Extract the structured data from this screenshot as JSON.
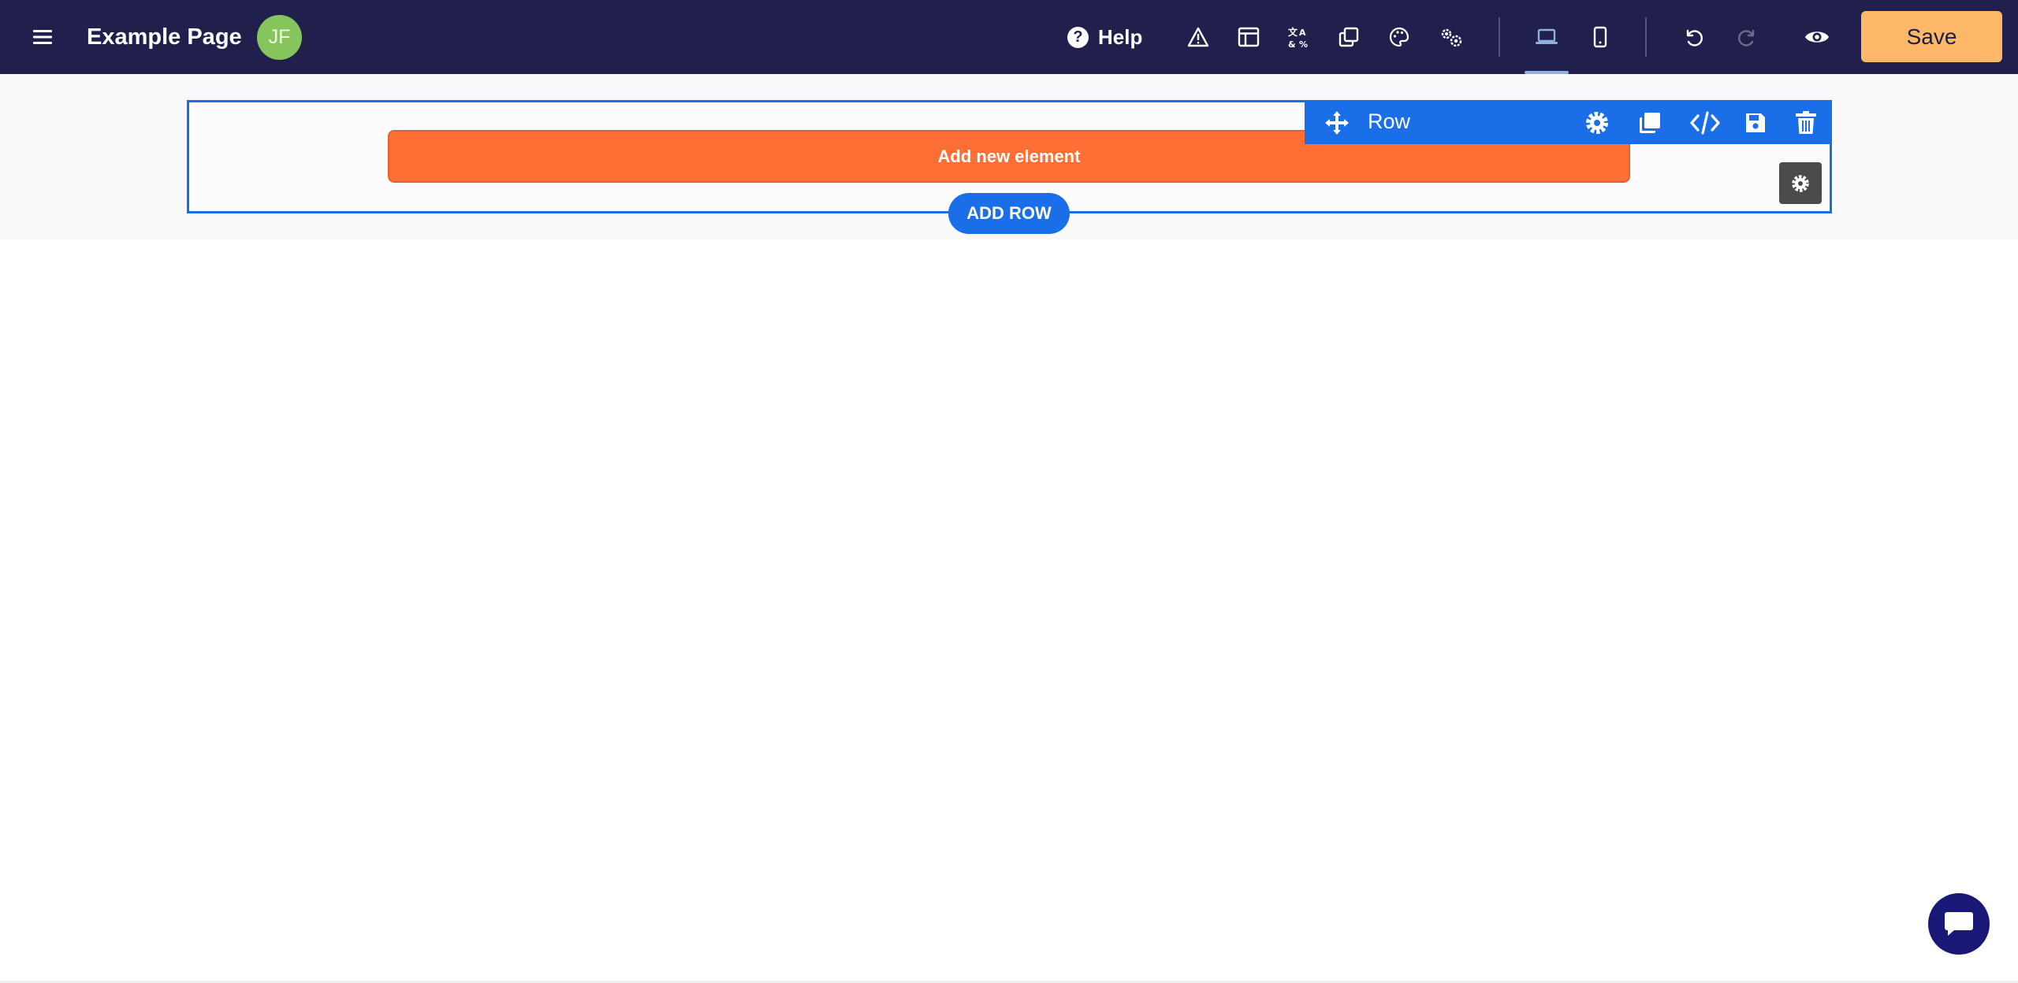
{
  "app": {
    "page_title": "Example Page",
    "avatar_initials": "JF",
    "help_label": "Help",
    "save_label": "Save"
  },
  "toolbar_icons": [
    "warning-icon",
    "layout-icon",
    "translate-icon",
    "copy-icon",
    "palette-icon",
    "settings-gears-icon",
    "desktop-view-icon",
    "mobile-view-icon",
    "undo-icon",
    "redo-icon",
    "preview-eye-icon"
  ],
  "canvas": {
    "row_label": "Row",
    "add_element_label": "Add new element",
    "add_row_label": "ADD ROW"
  },
  "colors": {
    "topbar": "#21204d",
    "accent_blue": "#1a6fe8",
    "add_element_orange": "#ff6f35",
    "save_button": "#fdb86a",
    "avatar_green": "#86c55b",
    "chat_button": "#1a1877"
  }
}
